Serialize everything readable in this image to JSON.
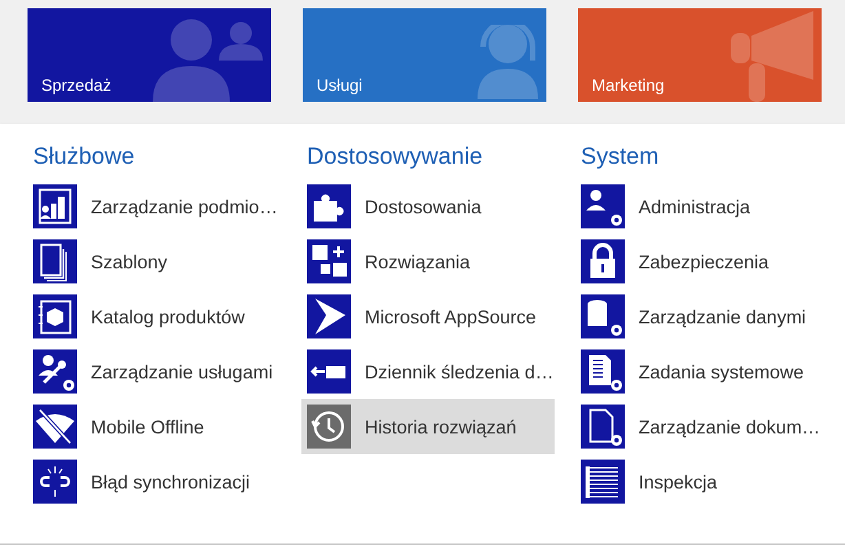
{
  "tiles": [
    {
      "label": "Sprzedaż",
      "color": "#1216a0"
    },
    {
      "label": "Usługi",
      "color": "#2670c4"
    },
    {
      "label": "Marketing",
      "color": "#d9512c"
    }
  ],
  "groups": [
    {
      "title": "Służbowe",
      "items": [
        {
          "label": "Zarządzanie podmio…",
          "selected": false
        },
        {
          "label": "Szablony",
          "selected": false
        },
        {
          "label": "Katalog produktów",
          "selected": false
        },
        {
          "label": "Zarządzanie usługami",
          "selected": false
        },
        {
          "label": "Mobile Offline",
          "selected": false
        },
        {
          "label": "Błąd synchronizacji",
          "selected": false
        }
      ]
    },
    {
      "title": "Dostosowywanie",
      "items": [
        {
          "label": "Dostosowania",
          "selected": false
        },
        {
          "label": "Rozwiązania",
          "selected": false
        },
        {
          "label": "Microsoft AppSource",
          "selected": false
        },
        {
          "label": "Dziennik śledzenia d…",
          "selected": false
        },
        {
          "label": "Historia rozwiązań",
          "selected": true
        }
      ]
    },
    {
      "title": "System",
      "items": [
        {
          "label": "Administracja",
          "selected": false
        },
        {
          "label": "Zabezpieczenia",
          "selected": false
        },
        {
          "label": "Zarządzanie danymi",
          "selected": false
        },
        {
          "label": "Zadania systemowe",
          "selected": false
        },
        {
          "label": "Zarządzanie dokum…",
          "selected": false
        },
        {
          "label": "Inspekcja",
          "selected": false
        }
      ]
    }
  ]
}
